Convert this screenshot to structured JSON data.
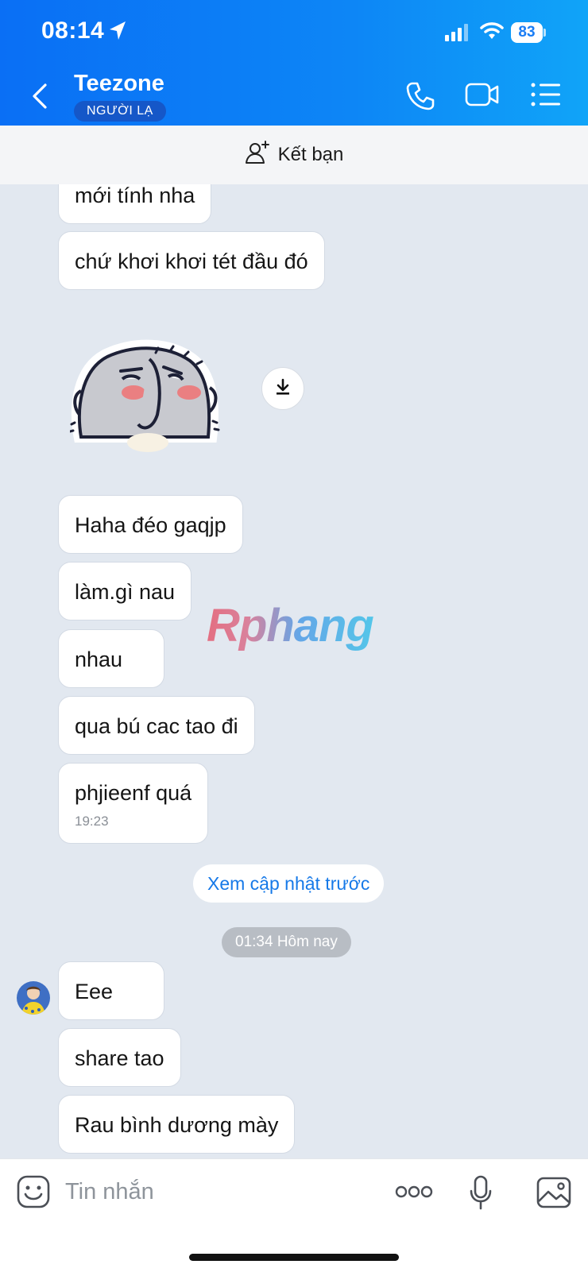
{
  "status_bar": {
    "time": "08:14",
    "battery": "83"
  },
  "header": {
    "title": "Teezone",
    "badge": "NGƯỜI LẠ"
  },
  "add_friend": {
    "label": "Kết bạn"
  },
  "messages_before": [
    {
      "text": "mới tính nha"
    },
    {
      "text": "chứ khơi khơi tét đầu đó"
    },
    {
      "text": "Haha đéo gaqjp"
    },
    {
      "text": "làm.gì nau"
    },
    {
      "text": "nhau"
    },
    {
      "text": "qua bú cac tao đi"
    },
    {
      "text": "phjieenf quá",
      "time": "19:23"
    }
  ],
  "watermark": "Rphang",
  "view_previous": "Xem cập nhật trước",
  "day_separator": "01:34 Hôm nay",
  "messages_after": [
    {
      "text": "Eee"
    },
    {
      "text": "share tao"
    },
    {
      "text": "Rau bình dương mày"
    }
  ],
  "composer": {
    "placeholder": "Tin nhắn"
  },
  "colors": {
    "header_blue": "#0d86f6",
    "link_blue": "#1679e8",
    "chat_bg": "#e2e8f0"
  }
}
